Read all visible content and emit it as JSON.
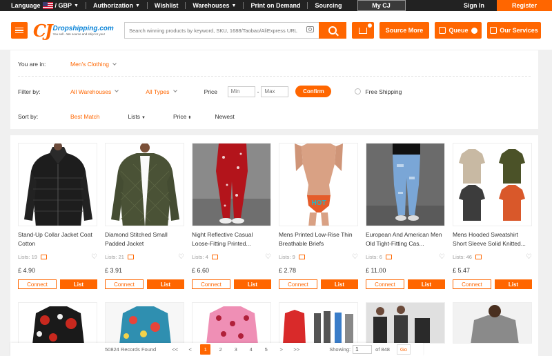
{
  "topbar": {
    "language": "Language",
    "currency": "/ GBP",
    "authorization": "Authorization",
    "wishlist": "Wishlist",
    "warehouses": "Warehouses",
    "print_on_demand": "Print on Demand",
    "sourcing": "Sourcing",
    "my_cj": "My CJ",
    "sign_in": "Sign In",
    "register": "Register"
  },
  "header": {
    "logo_mark": "CJ",
    "logo_name": "Dropshipping.com",
    "logo_tagline": "You sell - We source and ship for you!",
    "search_placeholder": "Search winning products by keyword, SKU, 1688/Taobao/AliExpress URL",
    "source_more": "Source More",
    "queue": "Queue",
    "our_services": "Our Services"
  },
  "filters": {
    "you_are_in_label": "You are in:",
    "category": "Men's Clothing",
    "filter_by_label": "Filter by:",
    "warehouses": "All Warehouses",
    "types": "All Types",
    "price_label": "Price",
    "min_placeholder": "Min",
    "price_dash": "-",
    "max_placeholder": "Max",
    "confirm": "Confirm",
    "free_shipping": "Free Shipping",
    "sort_by_label": "Sort by:",
    "sort_best_match": "Best Match",
    "sort_lists": "Lists",
    "sort_price": "Price",
    "sort_newest": "Newest"
  },
  "products": [
    {
      "name": "Stand-Up Collar Jacket Coat Cotton",
      "lists": "Lists: 19",
      "price": "£ 4.90"
    },
    {
      "name": "Diamond Stitched Small Padded Jacket",
      "lists": "Lists: 21",
      "price": "£ 3.91"
    },
    {
      "name": "Night Reflective Casual Loose-Fitting Printed...",
      "lists": "Lists: 4",
      "price": "£ 6.60"
    },
    {
      "name": "Mens Printed Low-Rise Thin Breathable Briefs",
      "lists": "Lists: 9",
      "price": "£ 2.78"
    },
    {
      "name": "European And American Men Old Tight-Fitting Cas...",
      "lists": "Lists: 6",
      "price": "£ 11.00"
    },
    {
      "name": "Mens Hooded Sweatshirt Short Sleeve Solid Knitted...",
      "lists": "Lists: 46",
      "price": "£ 5.47"
    }
  ],
  "card_buttons": {
    "connect": "Connect",
    "list": "List"
  },
  "product_image_text": "HOT",
  "pagination": {
    "records": "50824 Records Found",
    "first": "<<",
    "prev": "<",
    "pages": [
      "1",
      "2",
      "3",
      "4",
      "5"
    ],
    "next": ">",
    "last": ">>",
    "showing_label": "Showing:",
    "current_page": "1",
    "of_total": "of 848",
    "go": "Go"
  },
  "colors": {
    "accent": "#ff6600",
    "topbar": "#222222"
  }
}
